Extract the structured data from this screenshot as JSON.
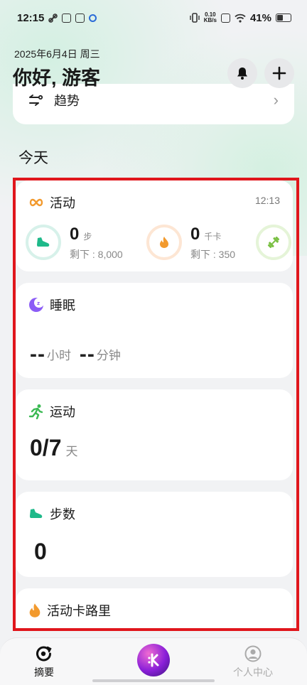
{
  "status": {
    "time": "12:15",
    "net_speed_value": "0.10",
    "net_speed_unit": "KB/s",
    "battery": "41%"
  },
  "header": {
    "date": "2025年6月4日 周三",
    "greeting": "你好, 游客"
  },
  "trend": {
    "label": "趋势"
  },
  "today": {
    "title": "今天"
  },
  "activity": {
    "title": "活动",
    "time": "12:13",
    "steps_value": "0",
    "steps_unit": "步",
    "steps_remaining": "剩下 : 8,000",
    "calories_value": "0",
    "calories_unit": "千卡",
    "calories_remaining": "剩下 : 350"
  },
  "sleep": {
    "title": "睡眠",
    "hours_value": "--",
    "hours_unit": "小时",
    "minutes_value": "--",
    "minutes_unit": "分钟"
  },
  "exercise": {
    "title": "运动",
    "value": "0/7",
    "unit": "天"
  },
  "steps_card": {
    "title": "步数",
    "value": "0"
  },
  "calories_card": {
    "title": "活动卡路里"
  },
  "nav": {
    "summary": "摘要",
    "profile": "个人中心"
  },
  "colors": {
    "steps_accent": "#1fb98a",
    "calories_accent": "#f29a2e",
    "exercise_accent": "#7ac043",
    "sleep_accent": "#8b5cf6",
    "highlight_frame": "#e0161c"
  }
}
